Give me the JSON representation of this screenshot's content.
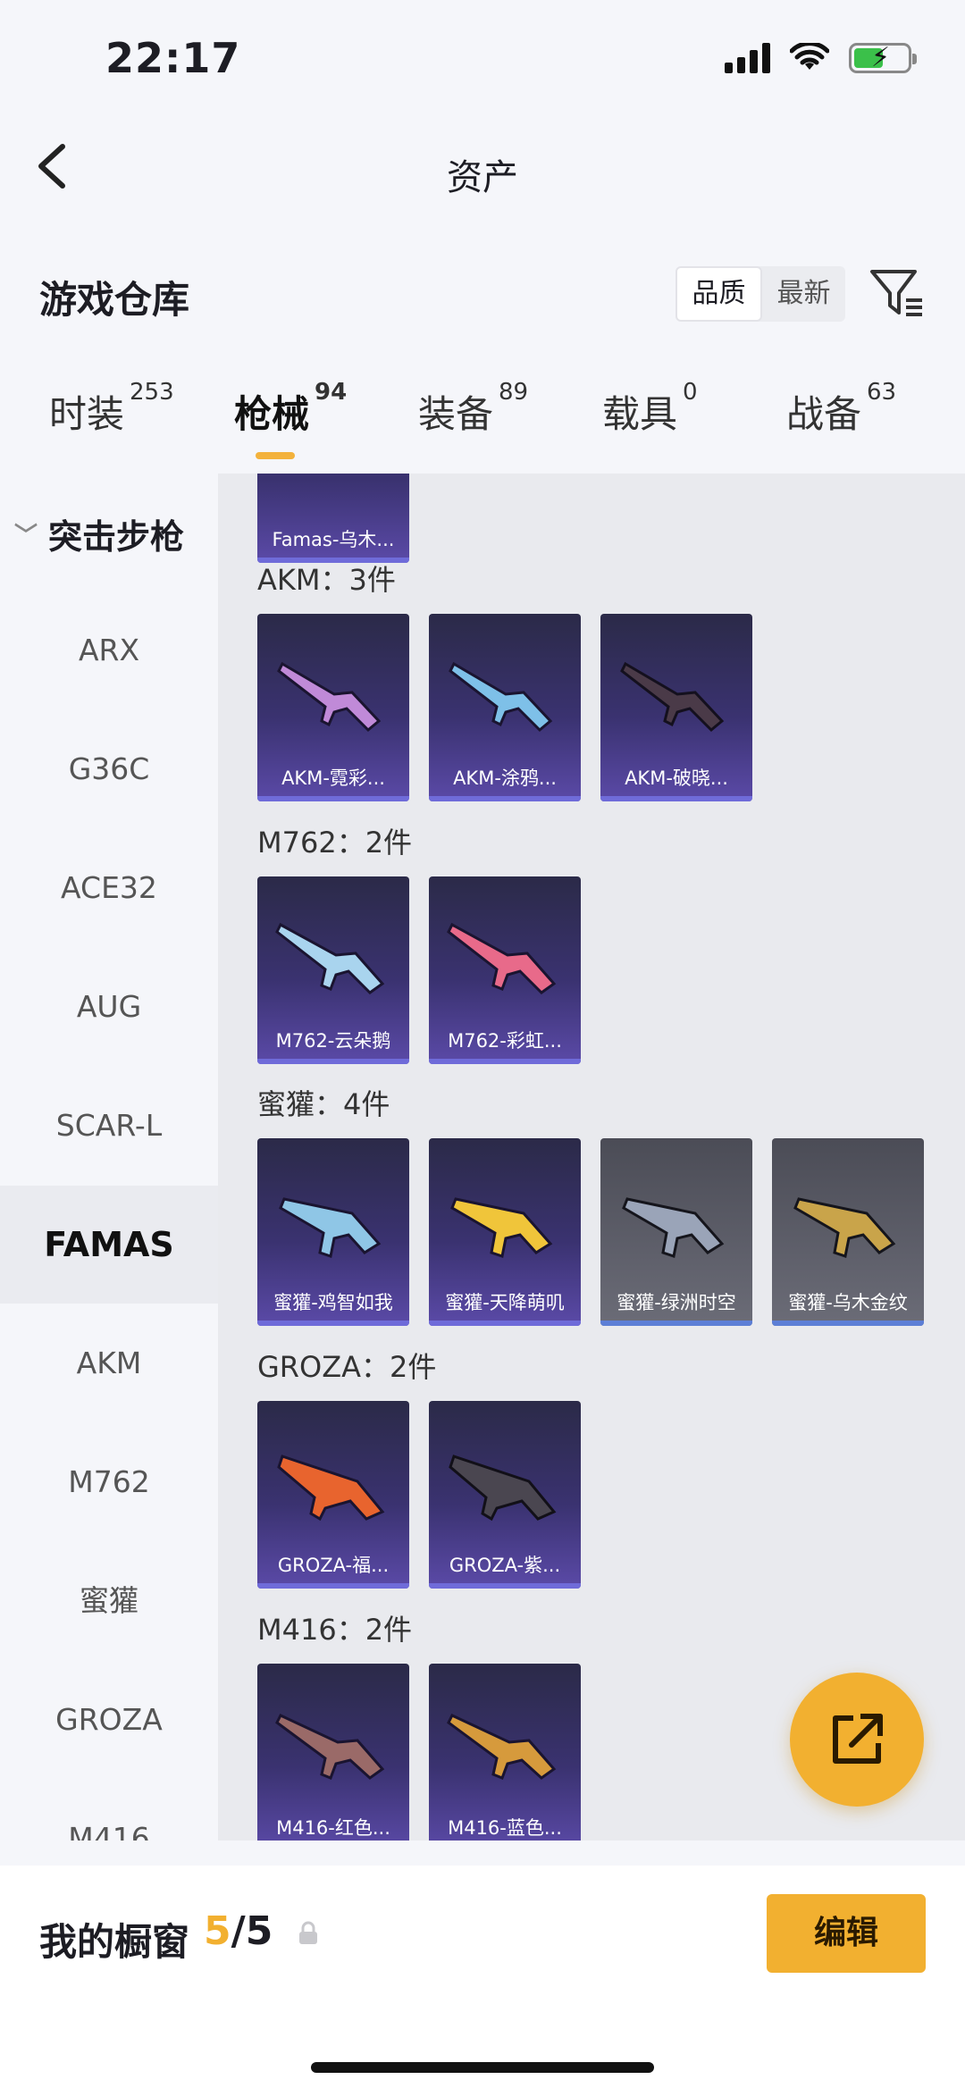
{
  "status_bar": {
    "time": "22:17"
  },
  "nav": {
    "title": "资产"
  },
  "warehouse": {
    "title": "游戏仓库",
    "sort_options": [
      "品质",
      "最新"
    ],
    "active_sort": "品质"
  },
  "tabs": [
    {
      "label": "时装",
      "count": "253"
    },
    {
      "label": "枪械",
      "count": "94"
    },
    {
      "label": "装备",
      "count": "89"
    },
    {
      "label": "载具",
      "count": "0"
    },
    {
      "label": "战备",
      "count": "63"
    }
  ],
  "active_tab": "枪械",
  "sidebar": {
    "category": "突击步枪",
    "items": [
      "ARX",
      "G36C",
      "ACE32",
      "AUG",
      "SCAR-L",
      "FAMAS",
      "AKM",
      "M762",
      "蜜獾",
      "GROZA",
      "M416"
    ],
    "selected": "FAMAS"
  },
  "groups": [
    {
      "title": "",
      "cards": [
        {
          "label": "Famas-乌木...",
          "style": "purple"
        }
      ]
    },
    {
      "title": "AKM：3件",
      "cards": [
        {
          "label": "AKM-霓彩...",
          "style": "purple"
        },
        {
          "label": "AKM-涂鸦...",
          "style": "purple"
        },
        {
          "label": "AKM-破晓...",
          "style": "purple"
        }
      ]
    },
    {
      "title": "M762：2件",
      "cards": [
        {
          "label": "M762-云朵鹅",
          "style": "purple"
        },
        {
          "label": "M762-彩虹...",
          "style": "purple"
        }
      ]
    },
    {
      "title": "蜜獾：4件",
      "cards": [
        {
          "label": "蜜獾-鸡智如我",
          "style": "purple"
        },
        {
          "label": "蜜獾-天降萌叽",
          "style": "purple"
        },
        {
          "label": "蜜獾-绿洲时空",
          "style": "grey"
        },
        {
          "label": "蜜獾-乌木金纹",
          "style": "grey"
        }
      ]
    },
    {
      "title": "GROZA：2件",
      "cards": [
        {
          "label": "GROZA-福...",
          "style": "purple"
        },
        {
          "label": "GROZA-紫...",
          "style": "purple"
        }
      ]
    },
    {
      "title": "M416：2件",
      "cards": [
        {
          "label": "M416-红色...",
          "style": "purple"
        },
        {
          "label": "M416-蓝色...",
          "style": "purple"
        }
      ]
    }
  ],
  "showcase": {
    "label": "我的橱窗",
    "current": "5",
    "total": "/5"
  },
  "edit_button": "编辑",
  "colors": {
    "accent": "#f2b030",
    "card_purple": "#3a3270",
    "card_grey": "#5e5f6a"
  },
  "icons": [
    "back-arrow-icon",
    "filter-icon",
    "share-icon",
    "lock-icon"
  ]
}
